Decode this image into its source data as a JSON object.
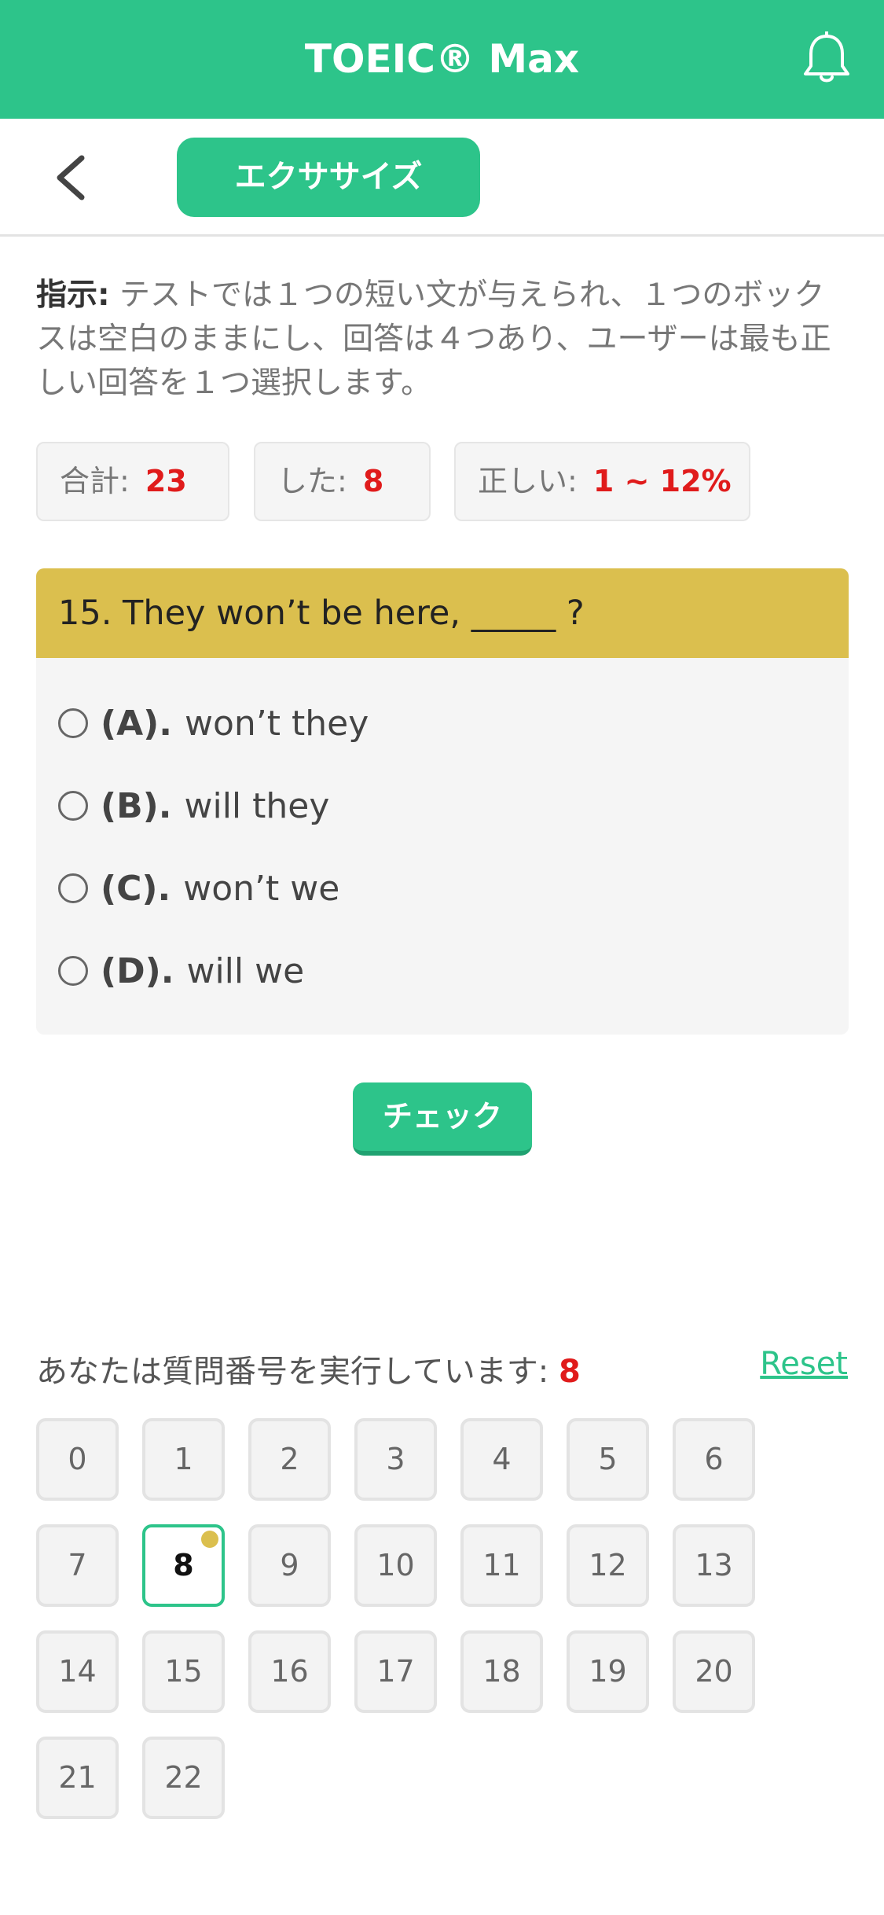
{
  "header": {
    "title": "TOEIC® Max",
    "notification_icon": "bell-icon"
  },
  "subbar": {
    "back_icon": "chevron-left-icon",
    "tab_label": "エクササイズ"
  },
  "instructions": {
    "prefix": "指示:",
    "text": "テストでは１つの短い文が与えられ、１つのボックスは空白のままにし、回答は４つあり、ユーザーは最も正しい回答を１つ選択します。"
  },
  "stats": {
    "total_label": "合計:",
    "total_value": "23",
    "done_label": "した:",
    "done_value": "8",
    "correct_label": "正しい:",
    "correct_value": "1 ~ 12%"
  },
  "question": {
    "text": "15. They won’t be here, _____ ?",
    "options": [
      {
        "letter": "(A).",
        "text": "won’t they"
      },
      {
        "letter": "(B).",
        "text": "will they"
      },
      {
        "letter": "(C).",
        "text": "won’t we"
      },
      {
        "letter": "(D).",
        "text": "will we"
      }
    ]
  },
  "check_button": "チェック",
  "navigator": {
    "label": "あなたは質問番号を実行しています:",
    "current": "8",
    "reset": "Reset",
    "numbers": [
      "0",
      "1",
      "2",
      "3",
      "4",
      "5",
      "6",
      "7",
      "8",
      "9",
      "10",
      "11",
      "12",
      "13",
      "14",
      "15",
      "16",
      "17",
      "18",
      "19",
      "20",
      "21",
      "22"
    ]
  },
  "colors": {
    "primary": "#2dc48a",
    "question_header": "#dbbf4e",
    "highlight_red": "#e01b1b"
  }
}
